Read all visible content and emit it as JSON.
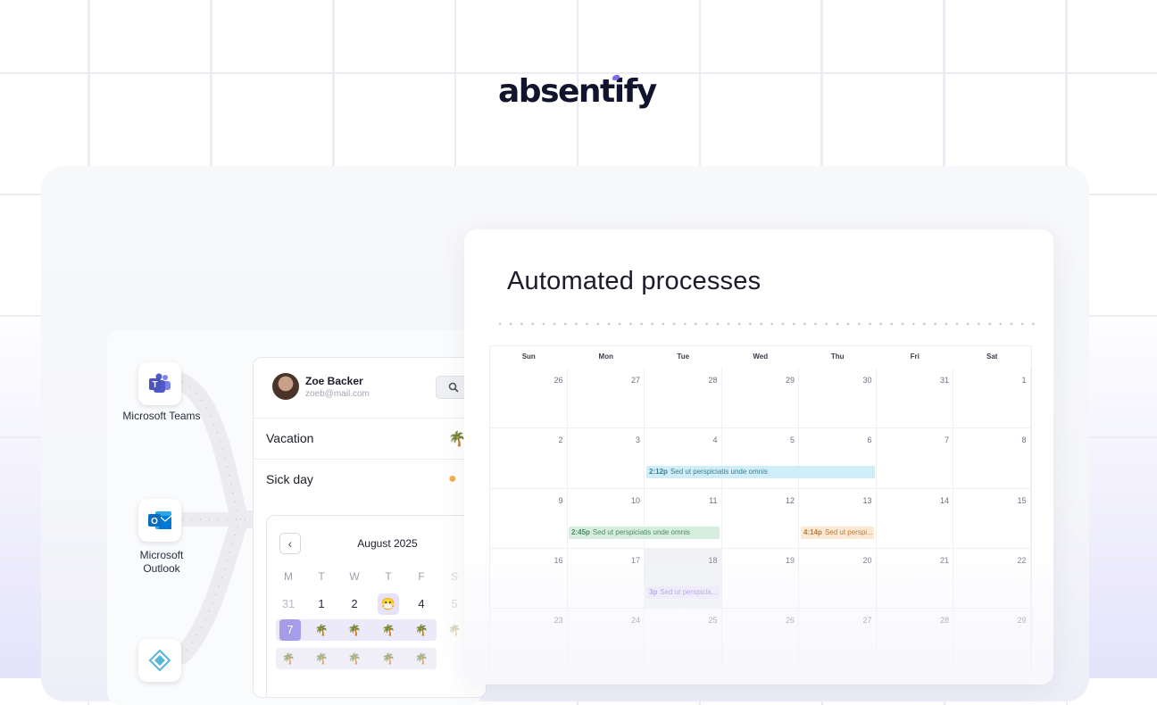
{
  "brand": {
    "logo_text": "absentify",
    "accent": "#7b6cf0"
  },
  "integrations": [
    {
      "name": "Microsoft Teams",
      "icon": "teams-icon",
      "color": "#5059c9"
    },
    {
      "name": "Microsoft Outlook",
      "icon": "outlook-icon",
      "color": "#0f6cbd"
    },
    {
      "name": "",
      "icon": "azure-icon",
      "color": "#59b4d9"
    }
  ],
  "profile": {
    "name": "Zoe Backer",
    "email": "zoeb@mail.com",
    "leave_types": [
      {
        "label": "Vacation",
        "icon": "palm-tree-icon"
      },
      {
        "label": "Sick day",
        "icon": "sick-icon"
      }
    ],
    "mini_calendar": {
      "month": "August 2025",
      "weekdays": [
        "M",
        "T",
        "W",
        "T",
        "F",
        "S"
      ],
      "first_row": [
        "31",
        "1",
        "2",
        "",
        "4",
        "5"
      ],
      "selected_day": "7"
    }
  },
  "calendar": {
    "title": "Automated processes",
    "weekdays": [
      "Sun",
      "Mon",
      "Tue",
      "Wed",
      "Thu",
      "Fri",
      "Sat"
    ],
    "weeks": [
      [
        "26",
        "27",
        "28",
        "29",
        "30",
        "31",
        "1"
      ],
      [
        "2",
        "3",
        "4",
        "5",
        "6",
        "7",
        "8"
      ],
      [
        "9",
        "10",
        "11",
        "12",
        "13",
        "14",
        "15"
      ],
      [
        "16",
        "17",
        "18",
        "19",
        "20",
        "21",
        "22"
      ],
      [
        "23",
        "24",
        "25",
        "26",
        "27",
        "28",
        "29"
      ]
    ],
    "events": [
      {
        "time": "2:12p",
        "title": "Sed ut perspiciatis unde omnis",
        "color": "blue"
      },
      {
        "time": "2:45p",
        "title": "Sed ut perspiciatis unde omnis",
        "color": "green"
      },
      {
        "time": "4:14p",
        "title": "Sed ut perspi...",
        "color": "orange"
      },
      {
        "time": "3p",
        "title": "Sed ut perspicia...",
        "color": "purple"
      }
    ]
  }
}
